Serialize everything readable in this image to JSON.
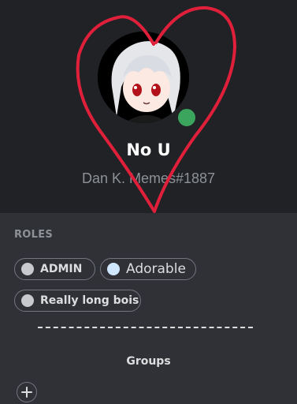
{
  "profile": {
    "display_name": "No U",
    "username": "Dan K. Memes#1887",
    "status": "online",
    "status_color": "#3ba55d"
  },
  "roles": {
    "header": "ROLES",
    "items": [
      {
        "label": "ADMIN",
        "color": "#c7c9cc"
      },
      {
        "label": "Adorable",
        "color": "#cfe7ff"
      },
      {
        "label": "Really long bois",
        "color": "#c7c9cc"
      }
    ]
  },
  "divider_text": "---------------------------------------------",
  "groups": {
    "label": "Groups"
  },
  "colors": {
    "top_bg": "#202225",
    "bottom_bg": "#2f3136",
    "heart": "#e0203a"
  },
  "icons": {
    "add": "plus-icon"
  }
}
